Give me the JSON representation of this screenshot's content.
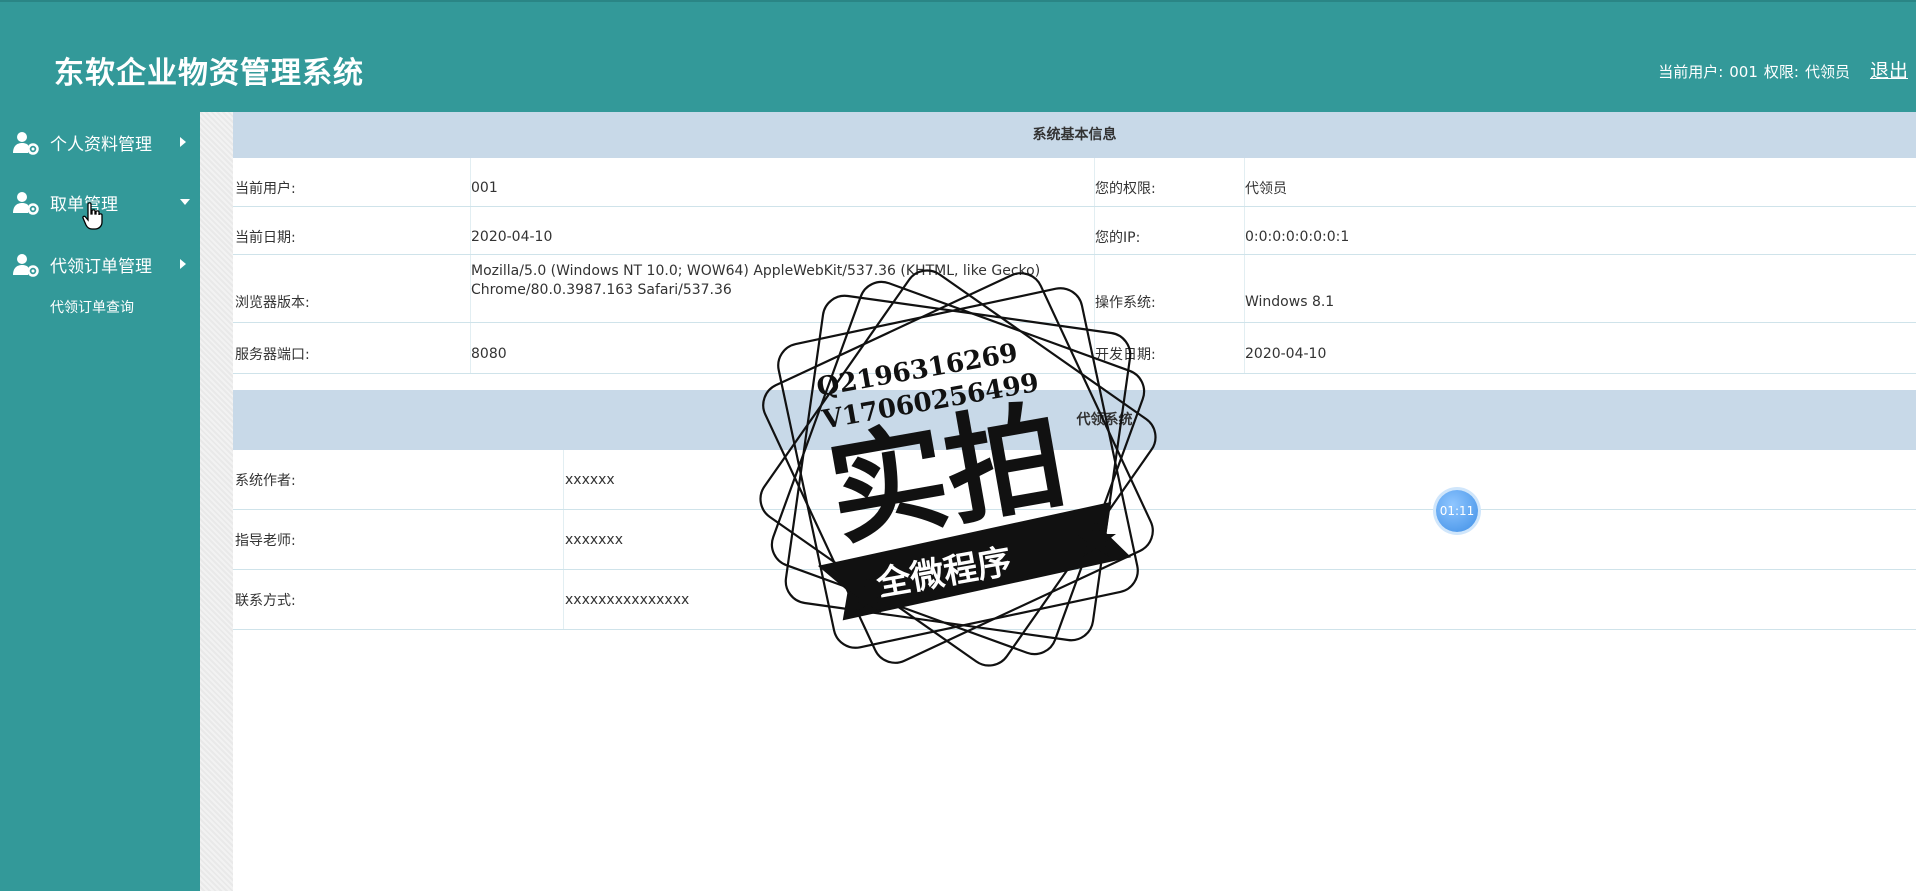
{
  "app": {
    "title": "东软企业物资管理系统"
  },
  "header": {
    "current_user_label": "当前用户:",
    "current_user": "001",
    "role_label": "权限:",
    "role": "代领员",
    "logout": "退出"
  },
  "sidebar": {
    "items": [
      {
        "label": "个人资料管理",
        "icon": "user-gear-icon",
        "arrow": "right"
      },
      {
        "label": "取单管理",
        "icon": "user-gear-icon",
        "arrow": "down"
      },
      {
        "label": "代领订单管理",
        "icon": "user-gear-icon",
        "arrow": "right"
      }
    ],
    "subitems": [
      {
        "label": "代领订单查询"
      }
    ]
  },
  "system_info": {
    "title": "系统基本信息",
    "rows": [
      {
        "label1": "当前用户:",
        "value1": "001",
        "label2": "您的权限:",
        "value2": "代领员"
      },
      {
        "label1": "当前日期:",
        "value1": "2020-04-10",
        "label2": "您的IP:",
        "value2": "0:0:0:0:0:0:0:1"
      },
      {
        "label1": "浏览器版本:",
        "value1": "Mozilla/5.0 (Windows NT 10.0; WOW64) AppleWebKit/537.36 (KHTML, like Gecko) Chrome/80.0.3987.163 Safari/537.36",
        "label2": "操作系统:",
        "value2": "Windows 8.1"
      },
      {
        "label1": "服务器端口:",
        "value1": "8080",
        "label2": "开发日期:",
        "value2": "2020-04-10"
      }
    ]
  },
  "project_info": {
    "title": "代领系统",
    "rows": [
      {
        "label": "系统作者:",
        "value": "xxxxxx"
      },
      {
        "label": "指导老师:",
        "value": "xxxxxxx"
      },
      {
        "label": "联系方式:",
        "value": "xxxxxxxxxxxxxxx"
      }
    ]
  },
  "watermark": {
    "line1": "Q2196316269",
    "line2": "V17060256499",
    "main": "实拍",
    "banner": "全微程序"
  },
  "timer": {
    "value": "01:11"
  },
  "colors": {
    "primary": "#339999",
    "section_header": "#c8d9e8",
    "divider": "#cfe3ea"
  }
}
